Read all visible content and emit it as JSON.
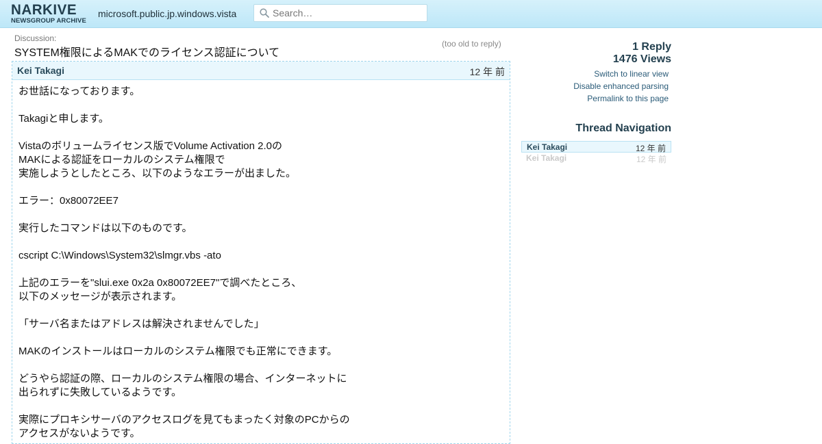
{
  "header": {
    "logo_main": "NARKIVE",
    "logo_sub": "NEWSGROUP ARCHIVE",
    "group": "microsoft.public.jp.windows.vista",
    "search_placeholder": "Search…"
  },
  "discussion": {
    "label": "Discussion:",
    "title": "SYSTEM権限によるMAKでのライセンス認証について",
    "note": "(too old to reply)"
  },
  "message": {
    "author": "Kei Takagi",
    "time": "12 年 前",
    "lines": [
      "お世話になっております。",
      "",
      "Takagiと申します。",
      "",
      "Vistaのボリュームライセンス版でVolume Activation 2.0の",
      "MAKによる認証をローカルのシステム権限で",
      "実施しようとしたところ、以下のようなエラーが出ました。",
      "",
      "エラー：0x80072EE7",
      "",
      "実行したコマンドは以下のものです。",
      "",
      "cscript C:\\Windows\\System32\\slmgr.vbs -ato",
      "",
      "上記のエラーを\"slui.exe 0x2a 0x80072EE7\"で調べたところ、",
      "以下のメッセージが表示されます。",
      "",
      "「サーバ名またはアドレスは解決されませんでした」",
      "",
      "MAKのインストールはローカルのシステム権限でも正常にできます。",
      "",
      "どうやら認証の際、ローカルのシステム権限の場合、インターネットに",
      "出られずに失敗しているようです。",
      "",
      "実際にプロキシサーバのアクセスログを見てもまったく対象のPCからの",
      "アクセスがないようです。"
    ]
  },
  "sidebar": {
    "replies": "1 Reply",
    "views": "1476 Views",
    "links": [
      "Switch to linear view",
      "Disable enhanced parsing",
      "Permalink to this page"
    ],
    "nav_title": "Thread Navigation",
    "nav_items": [
      {
        "author": "Kei Takagi",
        "time": "12 年 前"
      },
      {
        "author": "Kei Takagi",
        "time": "12 年 前"
      }
    ]
  }
}
